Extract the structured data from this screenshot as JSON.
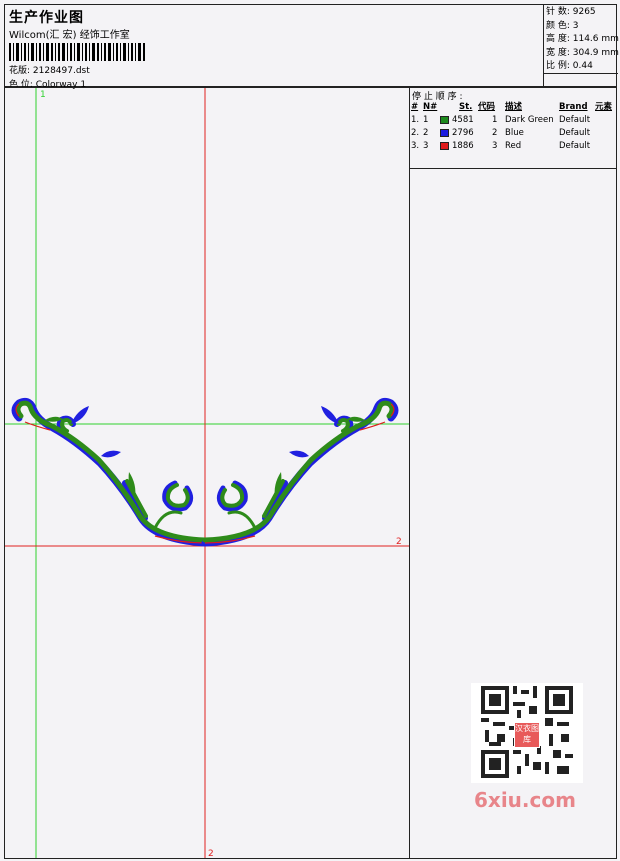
{
  "header": {
    "title": "生产作业图",
    "company": "Wilcom(汇 宏) 经饰工作室",
    "design_label": "花版: 2128497.dst",
    "colorway_label": "色 位:  Colorway 1"
  },
  "stats": {
    "stitches": "针 数: 9265",
    "colors": "颜 色: 3",
    "height": "高 度: 114.6 mm",
    "width": "宽 度: 304.9 mm",
    "scale": "比 例: 0.44"
  },
  "stop_sequence": {
    "title": "停 止 顺 序 :",
    "columns": {
      "hash": "#",
      "n": "N#",
      "st": "St.",
      "code": "代码",
      "desc": "描述",
      "brand": "Brand",
      "element": "元素"
    },
    "rows": [
      {
        "hash": "1.",
        "n": "1",
        "color": "#1d8a1d",
        "st": "4581",
        "code": "1",
        "desc": "Dark Green",
        "brand": "Default"
      },
      {
        "hash": "2.",
        "n": "2",
        "color": "#1c1ce0",
        "st": "2796",
        "code": "2",
        "desc": "Blue",
        "brand": "Default"
      },
      {
        "hash": "3.",
        "n": "3",
        "color": "#e01c1c",
        "st": "1886",
        "code": "3",
        "desc": "Red",
        "brand": "Default"
      }
    ]
  },
  "canvas": {
    "guide_green_label": "1",
    "guide_red_h_label": "2",
    "guide_red_v_label": "2"
  },
  "colors": {
    "dark_green": "#2e8b1a",
    "blue": "#2020e0",
    "red": "#e01c1c",
    "guide_green": "#2fd12f",
    "guide_red": "#e02020"
  },
  "watermark": {
    "seal_text": "汉衣图库",
    "site": "6xiu.com"
  }
}
